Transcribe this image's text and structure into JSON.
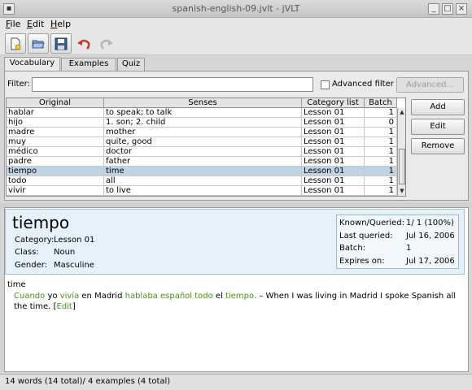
{
  "window": {
    "title": "spanish-english-09.jvlt - jVLT"
  },
  "menu": [
    {
      "label": "File",
      "mnemonic": "F",
      "rest": "ile"
    },
    {
      "label": "Edit",
      "mnemonic": "E",
      "rest": "dit"
    },
    {
      "label": "Help",
      "mnemonic": "H",
      "rest": "elp"
    }
  ],
  "tabs": [
    {
      "label": "Vocabulary"
    },
    {
      "label": "Examples"
    },
    {
      "label": "Quiz"
    }
  ],
  "filter": {
    "label": "Filter:",
    "value": "",
    "advanced_filter_label": "Advanced filter",
    "advanced_filter_checked": false,
    "advanced_button": "Advanced..."
  },
  "table": {
    "columns": [
      "Original",
      "Senses",
      "Category list",
      "Batch"
    ],
    "rows": [
      {
        "original": "hablar",
        "senses": "to speak; to talk",
        "category": "Lesson 01",
        "batch": "1",
        "selected": false
      },
      {
        "original": "hijo",
        "senses": "1. son; 2. child",
        "category": "Lesson 01",
        "batch": "0",
        "selected": false
      },
      {
        "original": "madre",
        "senses": "mother",
        "category": "Lesson 01",
        "batch": "1",
        "selected": false
      },
      {
        "original": "muy",
        "senses": "quite, good",
        "category": "Lesson 01",
        "batch": "1",
        "selected": false
      },
      {
        "original": "médico",
        "senses": "doctor",
        "category": "Lesson 01",
        "batch": "1",
        "selected": false
      },
      {
        "original": "padre",
        "senses": "father",
        "category": "Lesson 01",
        "batch": "1",
        "selected": false
      },
      {
        "original": "tiempo",
        "senses": "time",
        "category": "Lesson 01",
        "batch": "1",
        "selected": true
      },
      {
        "original": "todo",
        "senses": "all",
        "category": "Lesson 01",
        "batch": "1",
        "selected": false
      },
      {
        "original": "vivir",
        "senses": "to live",
        "category": "Lesson 01",
        "batch": "1",
        "selected": false
      }
    ]
  },
  "side_buttons": {
    "add": "Add",
    "edit": "Edit",
    "remove": "Remove"
  },
  "entry": {
    "word": "tiempo",
    "category_label": "Category:",
    "category_value": "Lesson 01",
    "class_label": "Class:",
    "class_value": "Noun",
    "gender_label": "Gender:",
    "gender_value": "Masculine",
    "stats": {
      "known_label": "Known/Queried:",
      "known_value": "1/ 1 (100%)",
      "last_label": "Last queried:",
      "last_value": "Jul 16, 2006",
      "batch_label": "Batch:",
      "batch_value": "1",
      "expires_label": "Expires on:",
      "expires_value": "Jul 17, 2006"
    },
    "sense": "time",
    "example": {
      "w1": "Cuando",
      "w2": "yo",
      "w3": "vivía",
      "w4": "en Madrid",
      "w5": "hablaba español todo",
      "w6": "el",
      "w7": "tiempo.",
      "translation": "– When I was living in Madrid I spoke Spanish all the time.",
      "edit_link": "Edit"
    }
  },
  "status": {
    "text": "14 words (14 total)/ 4 examples (4 total)"
  },
  "icons": {
    "new": "new-file-icon",
    "open": "open-folder-icon",
    "save": "save-disk-icon",
    "undo": "undo-icon",
    "redo": "redo-icon"
  },
  "colors": {
    "selection": "#bfd3e7",
    "example_green": "#4f8f1f",
    "undo_red": "#c0392b"
  }
}
